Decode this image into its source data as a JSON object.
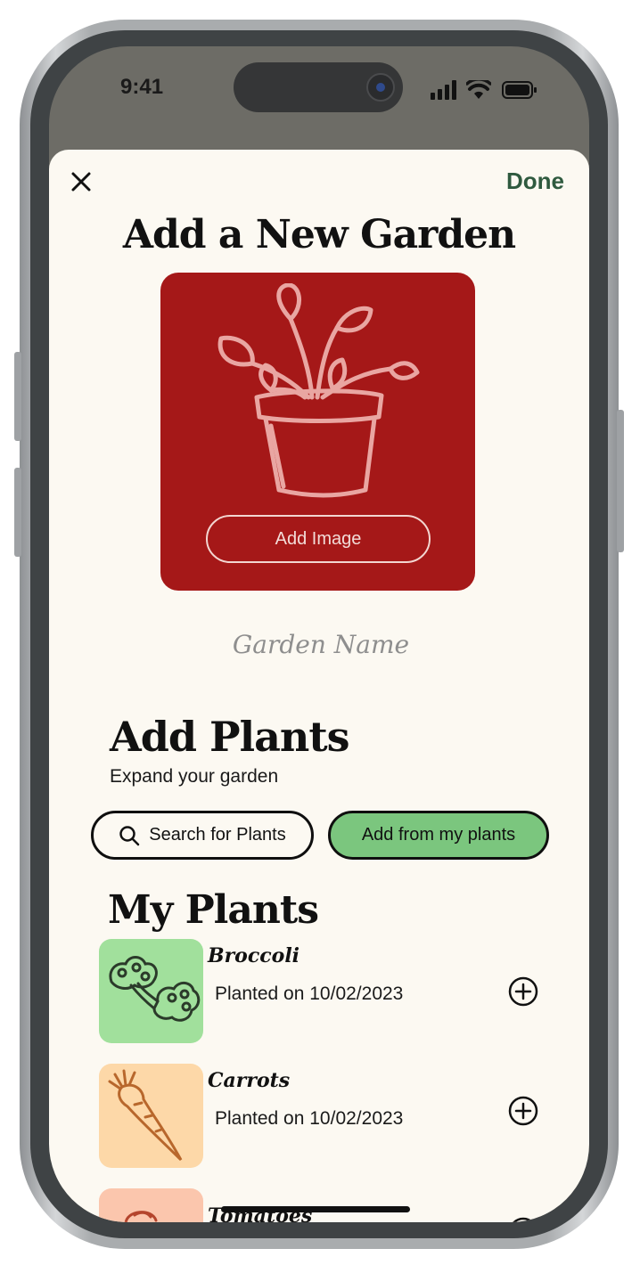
{
  "status_bar": {
    "time": "9:41",
    "icons": [
      "signal-icon",
      "wifi-icon",
      "battery-icon"
    ]
  },
  "header": {
    "close_icon": "close-icon",
    "done_label": "Done",
    "title": "Add a New Garden"
  },
  "image_card": {
    "background": "#a51818",
    "illustration": "potted-plant-icon",
    "add_image_label": "Add Image"
  },
  "garden_name": {
    "placeholder": "Garden Name",
    "value": ""
  },
  "add_plants": {
    "title": "Add Plants",
    "subtitle": "Expand your garden",
    "search_label": "Search for Plants",
    "add_from_mine_label": "Add from my plants",
    "accent": "#7bc67e"
  },
  "my_plants": {
    "title": "My Plants",
    "items": [
      {
        "name": "Broccoli",
        "date_text": "Planted on 10/02/2023",
        "thumb_color": "#a1e09c",
        "icon": "broccoli-icon"
      },
      {
        "name": "Carrots",
        "date_text": "Planted on 10/02/2023",
        "thumb_color": "#fdd8a8",
        "icon": "carrot-icon"
      },
      {
        "name": "Tomatoes",
        "date_text": "",
        "thumb_color": "#fbc6ad",
        "icon": "tomato-icon"
      }
    ]
  },
  "colors": {
    "sheet_background": "#fcf9f2",
    "done_text": "#2f5a3f"
  }
}
